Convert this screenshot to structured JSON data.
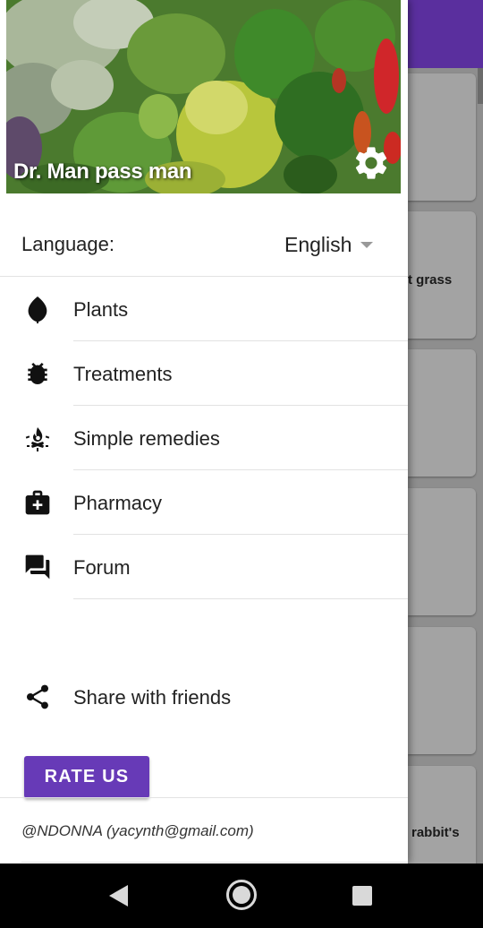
{
  "background_app": {
    "card_texts": [
      "t grass",
      "rabbit's"
    ]
  },
  "drawer": {
    "header": {
      "title": "Dr. Man pass man"
    },
    "language": {
      "label": "Language:",
      "selected": "English"
    },
    "menu": [
      {
        "label": "Plants",
        "icon": "leaf-icon"
      },
      {
        "label": "Treatments",
        "icon": "bug-icon"
      },
      {
        "label": "Simple remedies",
        "icon": "campfire-icon"
      },
      {
        "label": "Pharmacy",
        "icon": "medical-kit-icon"
      },
      {
        "label": "Forum",
        "icon": "forum-icon"
      }
    ],
    "share": {
      "label": "Share with friends",
      "icon": "share-icon"
    },
    "rate_button": "RATE US",
    "footer": "@NDONNA (yacynth@gmail.com)"
  },
  "colors": {
    "accent": "#673ab7",
    "appbar": "#5a2f9e"
  }
}
